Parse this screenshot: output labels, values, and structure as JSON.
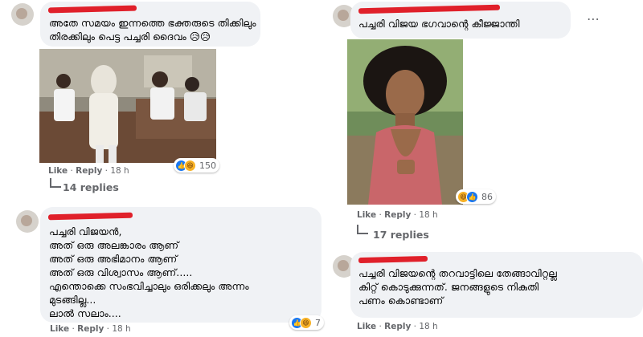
{
  "comments": [
    {
      "text": "അതേ സമയം ഇന്നത്തെ ഭക്തരുടെ തിക്കിലും\nതിരക്കിലും പെട്ട പച്ചരി ദൈവം 😥😥",
      "actions": {
        "like": "Like",
        "reply": "Reply",
        "time": "18 h"
      },
      "reaction_count": "150",
      "replies_label": "14 replies",
      "image_icon": "office-scene-meme-image"
    },
    {
      "text": "പച്ചരി വിജയൻ,\nഅത് ഒരു അലങ്കാരം ആണ്\nഅത് ഒരു അഭിമാനം ആണ്\nഅത് ഒരു വിശ്വാസം ആണ്.....\nഎന്തൊക്കെ സംഭവിച്ചാലും ഒരിക്കലും അന്നം\nമുടങ്ങില്ല...\nലാൽ സലാം....",
      "actions": {
        "like": "Like",
        "reply": "Reply",
        "time": "18 h"
      },
      "reaction_count": "7"
    },
    {
      "text": "പച്ചരി വിജയ ഭഗവാന്റെ കീജ്ജാന്തി",
      "actions": {
        "like": "Like",
        "reply": "Reply",
        "time": "18 h"
      },
      "reaction_count": "86",
      "replies_label": "17 replies",
      "more_icon": "more-options-icon",
      "image_icon": "afro-wig-man-meme-image"
    },
    {
      "text": "പച്ചരി വിജയന്റെ തറവാട്ടിലെ തേങ്ങാവിറ്റല്ല\nകിറ്റ് കൊടുക്കുന്നത്. ജനങ്ങളുടെ നികുതി\nപണം കൊണ്ടാണ്",
      "actions": {
        "like": "Like",
        "reply": "Reply",
        "time": "18 h"
      }
    }
  ],
  "colors": {
    "bubble": "#f0f2f5",
    "meta": "#65676b",
    "like_blue": "#1877f2",
    "haha_yellow": "#f7b125",
    "redaction": "#e0202a"
  }
}
